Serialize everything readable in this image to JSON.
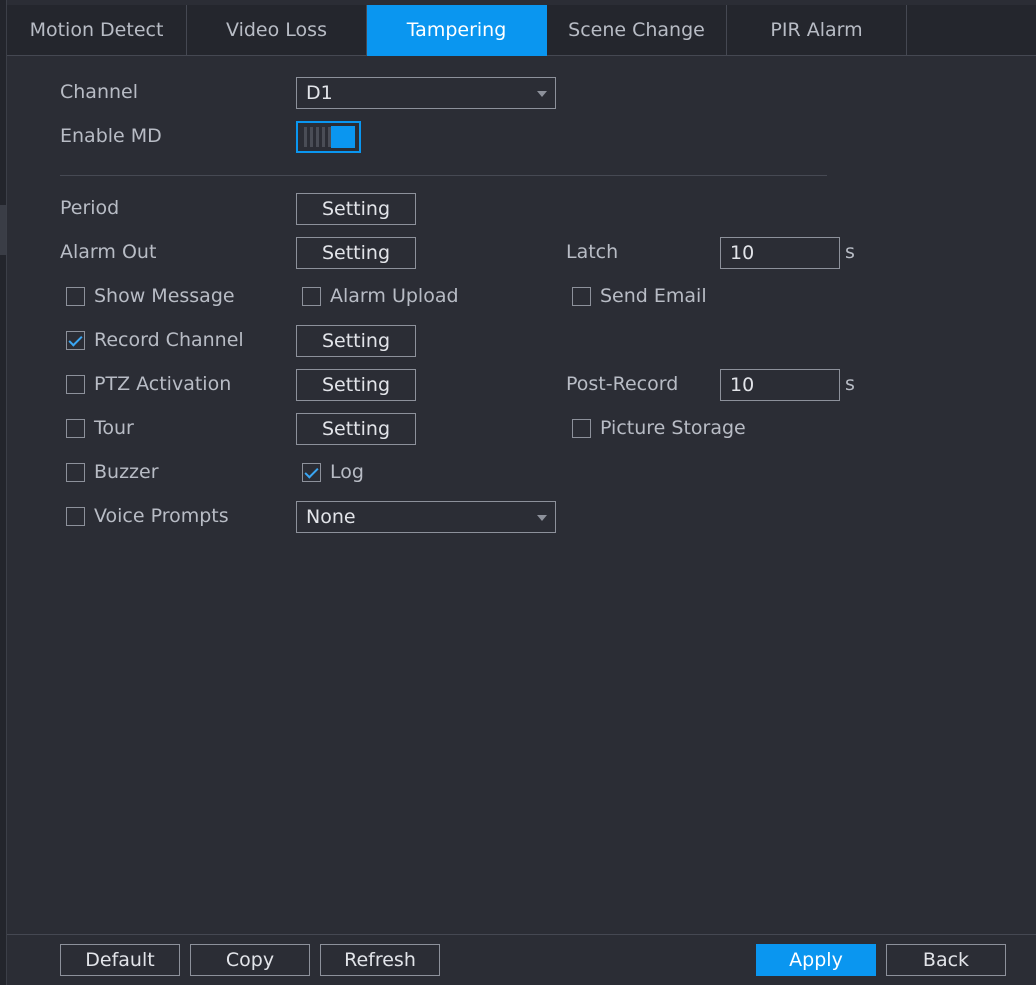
{
  "tabs": [
    {
      "label": "Motion Detect",
      "active": false
    },
    {
      "label": "Video Loss",
      "active": false
    },
    {
      "label": "Tampering",
      "active": true
    },
    {
      "label": "Scene Change",
      "active": false
    },
    {
      "label": "PIR Alarm",
      "active": false
    }
  ],
  "form": {
    "channel_label": "Channel",
    "channel_value": "D1",
    "enable_label": "Enable MD",
    "enable_on": true,
    "period_label": "Period",
    "alarm_out_label": "Alarm Out",
    "latch_label": "Latch",
    "latch_value": "10",
    "latch_unit": "s",
    "show_message_label": "Show Message",
    "show_message_checked": false,
    "alarm_upload_label": "Alarm Upload",
    "alarm_upload_checked": false,
    "send_email_label": "Send Email",
    "send_email_checked": false,
    "record_channel_label": "Record Channel",
    "record_channel_checked": true,
    "ptz_activation_label": "PTZ Activation",
    "ptz_activation_checked": false,
    "post_record_label": "Post-Record",
    "post_record_value": "10",
    "post_record_unit": "s",
    "tour_label": "Tour",
    "tour_checked": false,
    "picture_storage_label": "Picture Storage",
    "picture_storage_checked": false,
    "buzzer_label": "Buzzer",
    "buzzer_checked": false,
    "log_label": "Log",
    "log_checked": true,
    "voice_prompts_label": "Voice Prompts",
    "voice_prompts_checked": false,
    "voice_prompts_value": "None",
    "setting_label": "Setting"
  },
  "footer": {
    "default_label": "Default",
    "copy_label": "Copy",
    "refresh_label": "Refresh",
    "apply_label": "Apply",
    "back_label": "Back"
  },
  "colors": {
    "accent": "#0a96f0",
    "background": "#2b2d35",
    "text": "#b8bcc5"
  }
}
